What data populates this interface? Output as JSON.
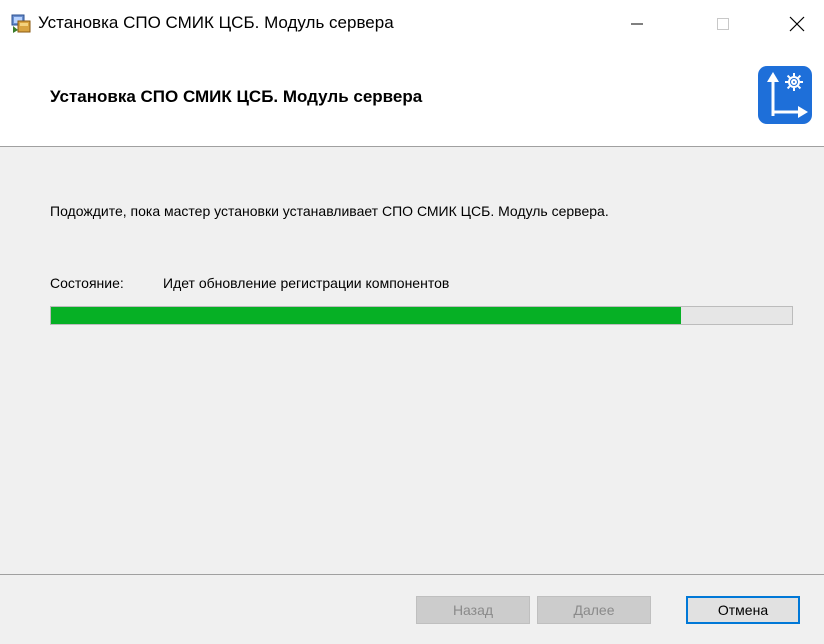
{
  "window": {
    "title": "Установка СПО СМИК ЦСБ. Модуль сервера",
    "app_icon": "installer-icon",
    "controls": {
      "minimize_icon": "minimize-icon",
      "maximize_icon": "maximize-icon",
      "close_icon": "close-icon"
    }
  },
  "banner": {
    "title": "Установка СПО СМИК ЦСБ. Модуль сервера",
    "logo_icon": "settings-arrow-logo-icon",
    "logo_color": "#1e6fd9"
  },
  "main": {
    "description": "Подождите, пока мастер установки устанавливает СПО СМИК ЦСБ. Модуль сервера.",
    "status_label": "Состояние:",
    "status_value": "Идет обновление регистрации компонентов",
    "progress_percent": 85,
    "progress_color": "#06b025"
  },
  "footer": {
    "back_label": "Назад",
    "next_label": "Далее",
    "cancel_label": "Отмена"
  }
}
